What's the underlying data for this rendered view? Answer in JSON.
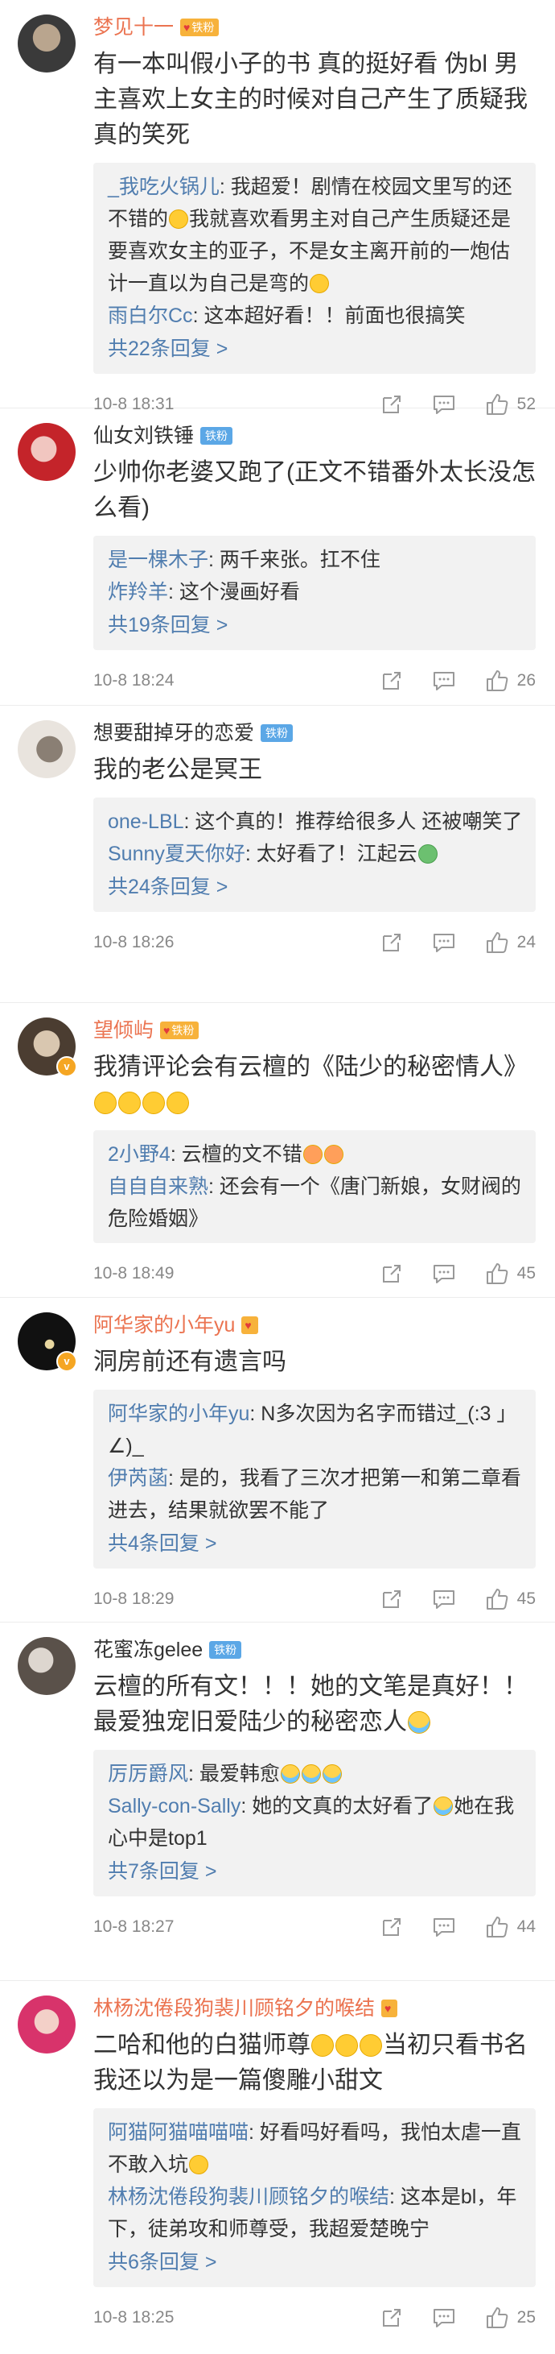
{
  "comments": [
    {
      "username": "梦见十一",
      "badge": "铁粉",
      "content": "有一本叫假小子的书 真的挺好看 伪bl 男主喜欢上女主的时候对自己产生了质疑我真的笑死",
      "replies": [
        {
          "user": "_我吃火锅儿",
          "text": ": 我超爱！剧情在校园文里写的还不错的",
          "text2": "我就喜欢看男主对自己产生质疑还是要喜欢女主的亚子，不是女主离开前的一炮估计一直以为自己是弯的"
        },
        {
          "user": "雨白尔Cc",
          "text": ": 这本超好看！！前面也很搞笑"
        }
      ],
      "more": "共22条回复 >",
      "timestamp": "10-8 18:31",
      "likes": "52"
    },
    {
      "username": "仙女刘铁锤",
      "badge": "铁粉",
      "content": "少帅你老婆又跑了(正文不错番外太长没怎么看)",
      "replies": [
        {
          "user": "是一棵木子",
          "text": ": 两千来张。扛不住"
        },
        {
          "user": "炸羚羊",
          "text": ": 这个漫画好看"
        }
      ],
      "more": "共19条回复 >",
      "timestamp": "10-8 18:24",
      "likes": "26"
    },
    {
      "username": "想要甜掉牙的恋爱",
      "badge": "铁粉",
      "content": "我的老公是冥王",
      "replies": [
        {
          "user": "one-LBL",
          "text": ": 这个真的！推荐给很多人 还被嘲笑了"
        },
        {
          "user": "Sunny夏天你好",
          "text": ": 太好看了！江起云"
        }
      ],
      "more": "共24条回复 >",
      "timestamp": "10-8 18:26",
      "likes": "24"
    },
    {
      "username": "望倾屿",
      "badge": "铁粉",
      "content": "我猜评论会有云檀的《陆少的秘密情人》",
      "replies": [
        {
          "user": "2小野4",
          "text": ": 云檀的文不错"
        },
        {
          "user": "自自自来熟",
          "text": ": 还会有一个《唐门新娘，女财阀的危险婚姻》"
        }
      ],
      "more": "",
      "timestamp": "10-8 18:49",
      "likes": "45"
    },
    {
      "username": "阿华家的小年yu",
      "badge": "",
      "content": "洞房前还有遗言吗",
      "replies": [
        {
          "user": "阿华家的小年yu",
          "text": ": N多次因为名字而错过_(:3 」∠)_"
        },
        {
          "user": "伊芮菡",
          "text": ": 是的，我看了三次才把第一和第二章看进去，结果就欲罢不能了"
        }
      ],
      "more": "共4条回复 >",
      "timestamp": "10-8 18:29",
      "likes": "45"
    },
    {
      "username": "花蜜冻gelee",
      "badge": "铁粉",
      "content": "云檀的所有文！！！她的文笔是真好！！最爱独宠旧爱陆少的秘密恋人",
      "replies": [
        {
          "user": "厉厉爵风",
          "text": ": 最爱韩愈"
        },
        {
          "user": "Sally-con-Sally",
          "text": ": 她的文真的太好看了",
          "text2": "她在我心中是top1"
        }
      ],
      "more": "共7条回复 >",
      "timestamp": "10-8 18:27",
      "likes": "44"
    },
    {
      "username": "林杨沈倦段狗裴川顾铭夕的喉结",
      "badge": "",
      "content": "二哈和他的白猫师尊",
      "content2": "当初只看书名我还以为是一篇傻雕小甜文",
      "replies": [
        {
          "user": "阿猫阿猫喵喵喵",
          "text": ": 好看吗好看吗，我怕太虐一直不敢入坑"
        },
        {
          "user": "林杨沈倦段狗裴川顾铭夕的喉结",
          "text": ": 这本是bl，年下，徒弟攻和师尊受，我超爱楚晚宁"
        }
      ],
      "more": "共6条回复 >",
      "timestamp": "10-8 18:25",
      "likes": "25"
    }
  ]
}
